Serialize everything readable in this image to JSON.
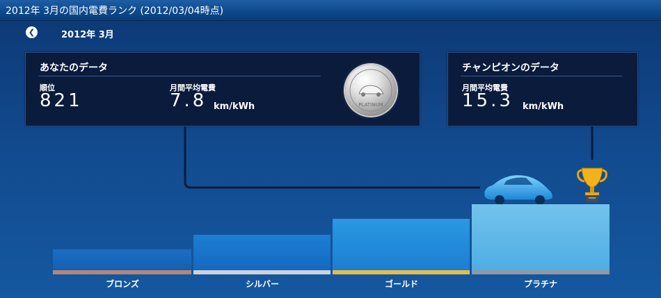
{
  "window": {
    "title": "2012年 3月の国内電費ランク (2012/03/04時点)"
  },
  "nav": {
    "period": "2012年 3月"
  },
  "your_data": {
    "title": "あなたのデータ",
    "rank_label": "順位",
    "rank_value": "821",
    "efficiency_label": "月間平均電費",
    "efficiency_value": "7.8",
    "unit": "km/kWh",
    "badge": "PLATINUM"
  },
  "champion_data": {
    "title": "チャンピオンのデータ",
    "efficiency_label": "月間平均電費",
    "efficiency_value": "15.3",
    "unit": "km/kWh"
  },
  "ranks": [
    {
      "label": "ブロンズ",
      "color": "#b3877a"
    },
    {
      "label": "シルバー",
      "color": "#cfd3d8"
    },
    {
      "label": "ゴールド",
      "color": "#e6bd4a"
    },
    {
      "label": "プラチナ",
      "color": "#9098a4"
    }
  ],
  "colors": {
    "background": "#0e3a73",
    "panel": "#0a1b3c",
    "accent_blue": "#1d7ed2"
  }
}
